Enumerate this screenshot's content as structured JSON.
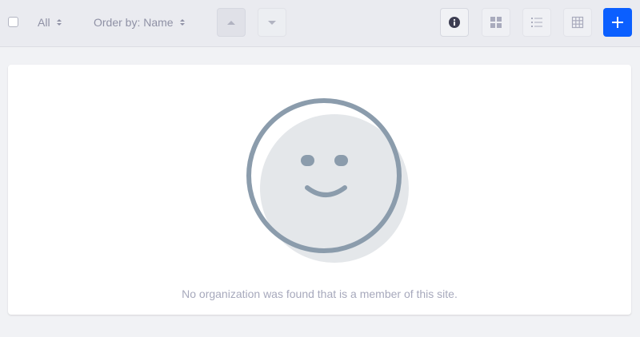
{
  "toolbar": {
    "filter_label": "All",
    "order_label": "Order by: Name",
    "actions": {
      "info": "info-icon",
      "cards": "cards-icon",
      "list": "list-icon",
      "table": "table-icon",
      "add": "plus-icon"
    }
  },
  "empty_state": {
    "message": "No organization was found that is a member of this site."
  },
  "colors": {
    "primary": "#0b5fff",
    "toolbar_bg": "#eaebf0",
    "page_bg": "#f1f2f5",
    "illustration_stroke": "#8b9cac",
    "illustration_fill": "#e4e7ea"
  }
}
